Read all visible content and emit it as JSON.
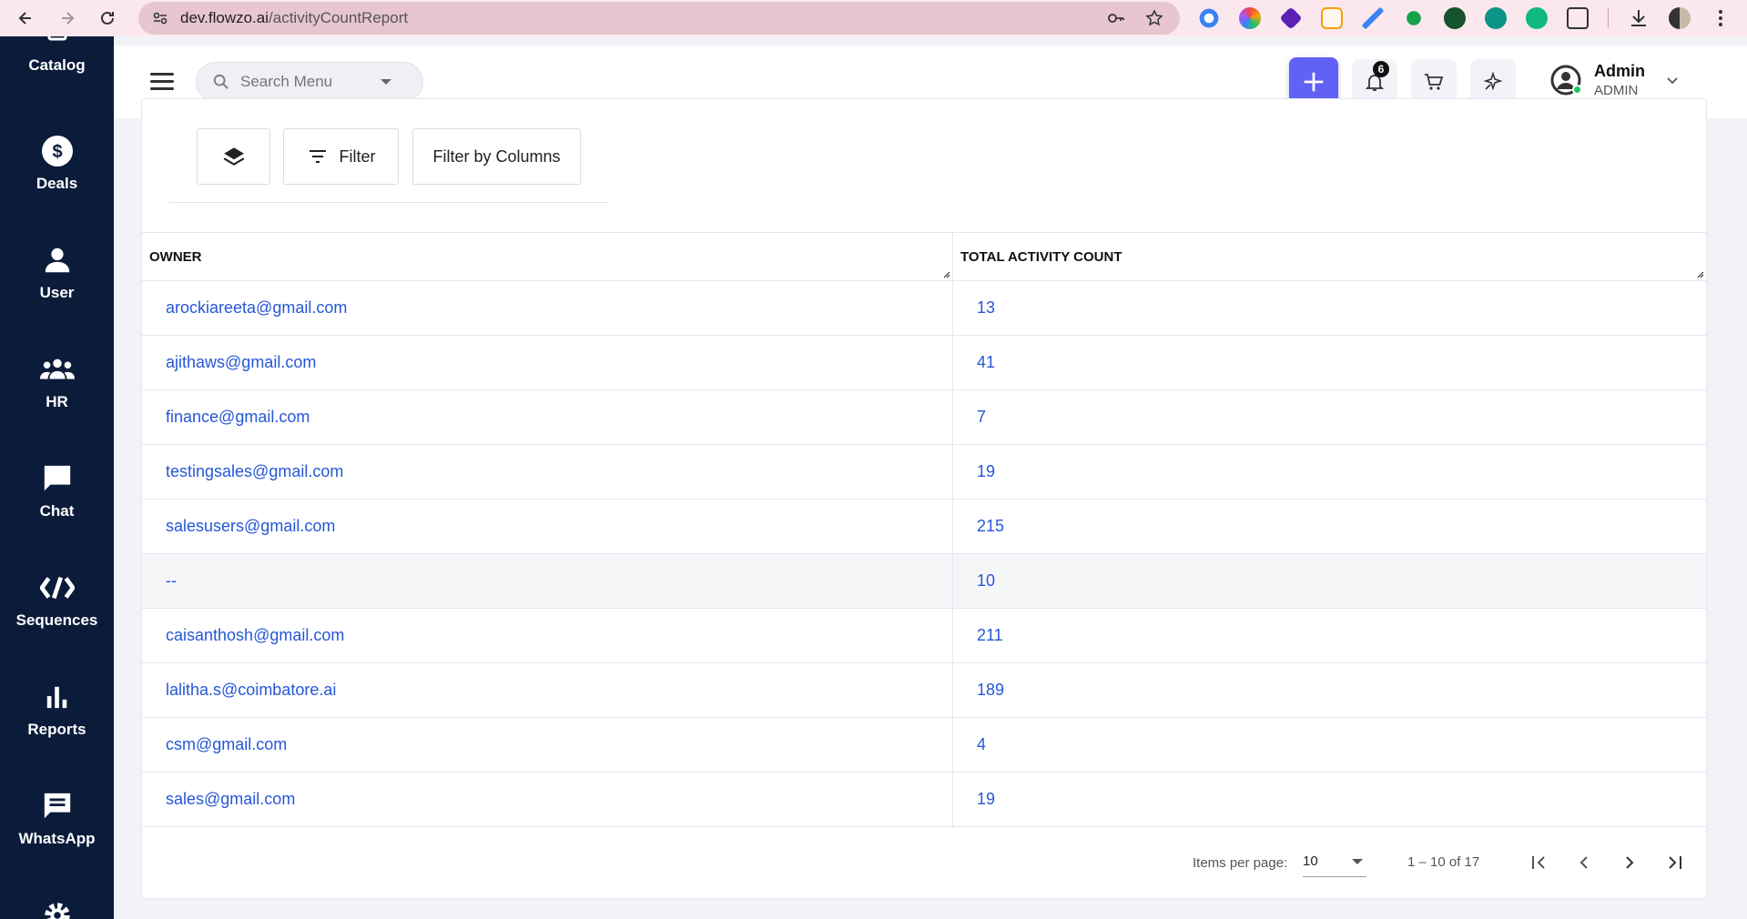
{
  "browser": {
    "url_host": "dev.flowzo.ai",
    "url_path": "/activityCountReport"
  },
  "sidebar": {
    "items": [
      {
        "label": "Catalog",
        "icon": "catalog-icon"
      },
      {
        "label": "Deals",
        "icon": "dollar-icon"
      },
      {
        "label": "User",
        "icon": "user-icon"
      },
      {
        "label": "HR",
        "icon": "group-icon"
      },
      {
        "label": "Chat",
        "icon": "chat-icon"
      },
      {
        "label": "Sequences",
        "icon": "sequences-icon"
      },
      {
        "label": "Reports",
        "icon": "bar-chart-icon"
      },
      {
        "label": "WhatsApp",
        "icon": "message-icon"
      }
    ]
  },
  "header": {
    "search_placeholder": "Search Menu",
    "notification_count": "6",
    "user_name": "Admin",
    "user_role": "ADMIN"
  },
  "toolbar": {
    "filter_label": "Filter",
    "filter_columns_label": "Filter by Columns"
  },
  "table": {
    "columns": [
      "OWNER",
      "TOTAL ACTIVITY COUNT"
    ],
    "rows": [
      {
        "owner": "arockiareeta@gmail.com",
        "count": "13"
      },
      {
        "owner": "ajithaws@gmail.com",
        "count": "41"
      },
      {
        "owner": "finance@gmail.com",
        "count": "7"
      },
      {
        "owner": "testingsales@gmail.com",
        "count": "19"
      },
      {
        "owner": "salesusers@gmail.com",
        "count": "215"
      },
      {
        "owner": "--",
        "count": "10"
      },
      {
        "owner": "caisanthosh@gmail.com",
        "count": "211"
      },
      {
        "owner": "lalitha.s@coimbatore.ai",
        "count": "189"
      },
      {
        "owner": "csm@gmail.com",
        "count": "4"
      },
      {
        "owner": "sales@gmail.com",
        "count": "19"
      }
    ]
  },
  "paginator": {
    "items_per_page_label": "Items per page:",
    "page_size": "10",
    "range_label": "1 – 10 of 17"
  },
  "colors": {
    "sidebar_bg": "#0b1c3a",
    "accent": "#6162f5",
    "link": "#2557d6"
  }
}
